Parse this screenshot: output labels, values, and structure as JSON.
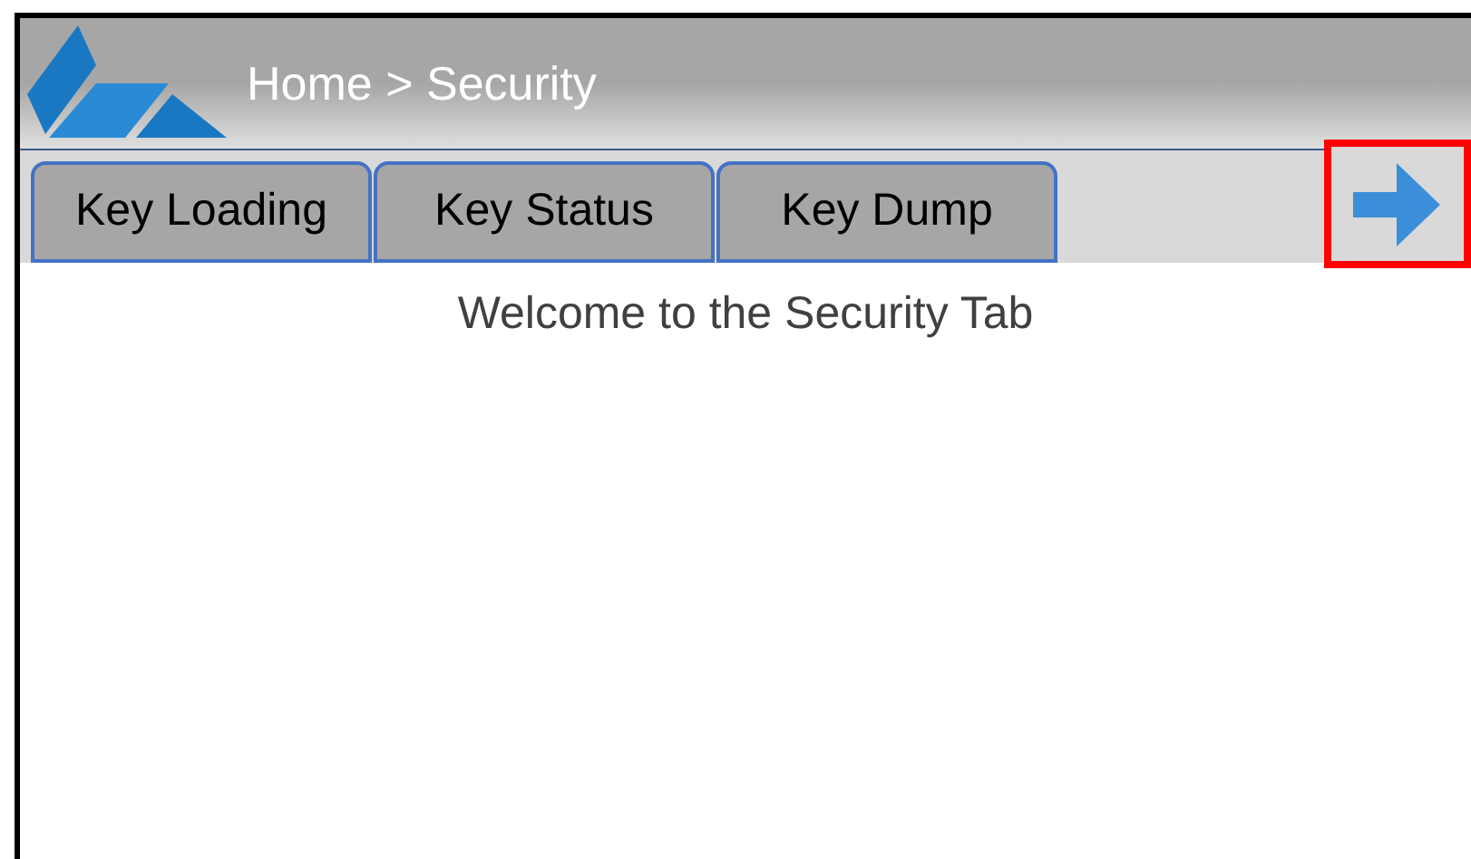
{
  "header": {
    "breadcrumb": "Home > Security"
  },
  "tabs": [
    {
      "label": "Key Loading"
    },
    {
      "label": "Key Status"
    },
    {
      "label": "Key Dump"
    }
  ],
  "welcome": "Welcome to the Security Tab"
}
